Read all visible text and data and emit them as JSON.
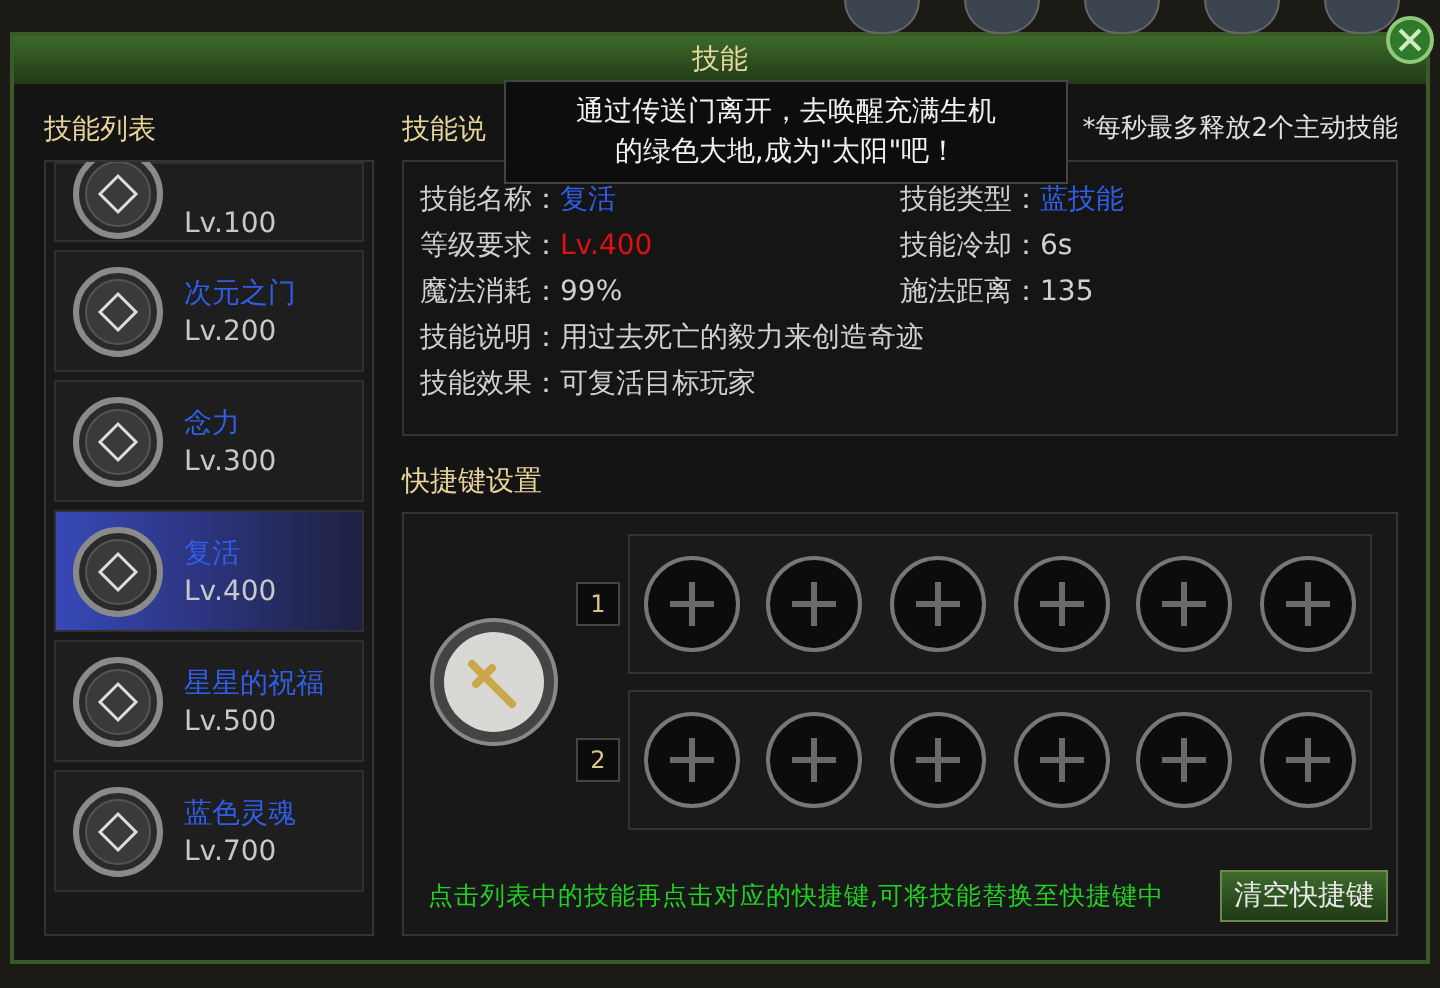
{
  "window": {
    "title": "技能"
  },
  "tooltip": {
    "lines": [
      "通过传送门离开，去唤醒充满生机",
      "的绿色大地,成为\"太阳\"吧！"
    ]
  },
  "skill_list": {
    "header": "技能列表",
    "items": [
      {
        "level": "Lv.100",
        "selected": false
      },
      {
        "name": "次元之门",
        "level": "Lv.200",
        "selected": false
      },
      {
        "name": "念力",
        "level": "Lv.300",
        "selected": false
      },
      {
        "name": "复活",
        "level": "Lv.400",
        "selected": true
      },
      {
        "name": "星星的祝福",
        "level": "Lv.500",
        "selected": false
      },
      {
        "name": "蓝色灵魂",
        "level": "Lv.700",
        "selected": false
      }
    ]
  },
  "details": {
    "header": "技能说",
    "note": "*每秒最多释放2个主动技能",
    "fields": [
      {
        "label": "技能名称：",
        "value": "复活",
        "kind": "blue"
      },
      {
        "label": "技能类型：",
        "value": "蓝技能",
        "kind": "blue"
      },
      {
        "label": "等级要求：",
        "value": "Lv.400",
        "kind": "red"
      },
      {
        "label": "技能冷却：",
        "value": "6s",
        "kind": "plain"
      },
      {
        "label": "魔法消耗：",
        "value": "99%",
        "kind": "plain"
      },
      {
        "label": "施法距离：",
        "value": "135",
        "kind": "plain"
      },
      {
        "label": "技能说明：",
        "value": "用过去死亡的毅力来创造奇迹",
        "kind": "wide"
      },
      {
        "label": "技能效果：",
        "value": "可复活目标玩家",
        "kind": "wide"
      }
    ]
  },
  "shortcuts": {
    "header": "快捷键设置",
    "rows": [
      {
        "number": "1"
      },
      {
        "number": "2"
      }
    ],
    "hint": "点击列表中的技能再点击对应的快捷键,可将技能替换至快捷键中",
    "clear_button": "清空快捷键"
  }
}
